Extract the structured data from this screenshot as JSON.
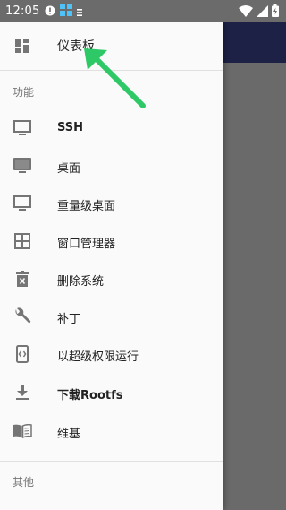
{
  "status_bar": {
    "time": "12:05"
  },
  "drawer": {
    "header": {
      "label": "仪表板",
      "icon": "dashboard-icon"
    },
    "sections": [
      {
        "title": "功能",
        "items": [
          {
            "label": "SSH",
            "icon": "monitor-icon"
          },
          {
            "label": "桌面",
            "icon": "desktop-icon"
          },
          {
            "label": "重量级桌面",
            "icon": "monitor-icon"
          },
          {
            "label": "窗口管理器",
            "icon": "grid-icon"
          },
          {
            "label": "删除系统",
            "icon": "trash-icon"
          },
          {
            "label": "补丁",
            "icon": "wrench-icon"
          },
          {
            "label": "以超级权限运行",
            "icon": "code-phone-icon"
          },
          {
            "label": "下载Rootfs",
            "icon": "download-icon"
          },
          {
            "label": "维基",
            "icon": "book-icon"
          }
        ]
      },
      {
        "title": "其他",
        "items": []
      }
    ]
  },
  "colors": {
    "toolbar": "#1d2145",
    "scrim": "#6b6b6b",
    "drawer_bg": "#fafafa",
    "icon_gray": "#757575",
    "arrow_green": "#2ec866"
  }
}
